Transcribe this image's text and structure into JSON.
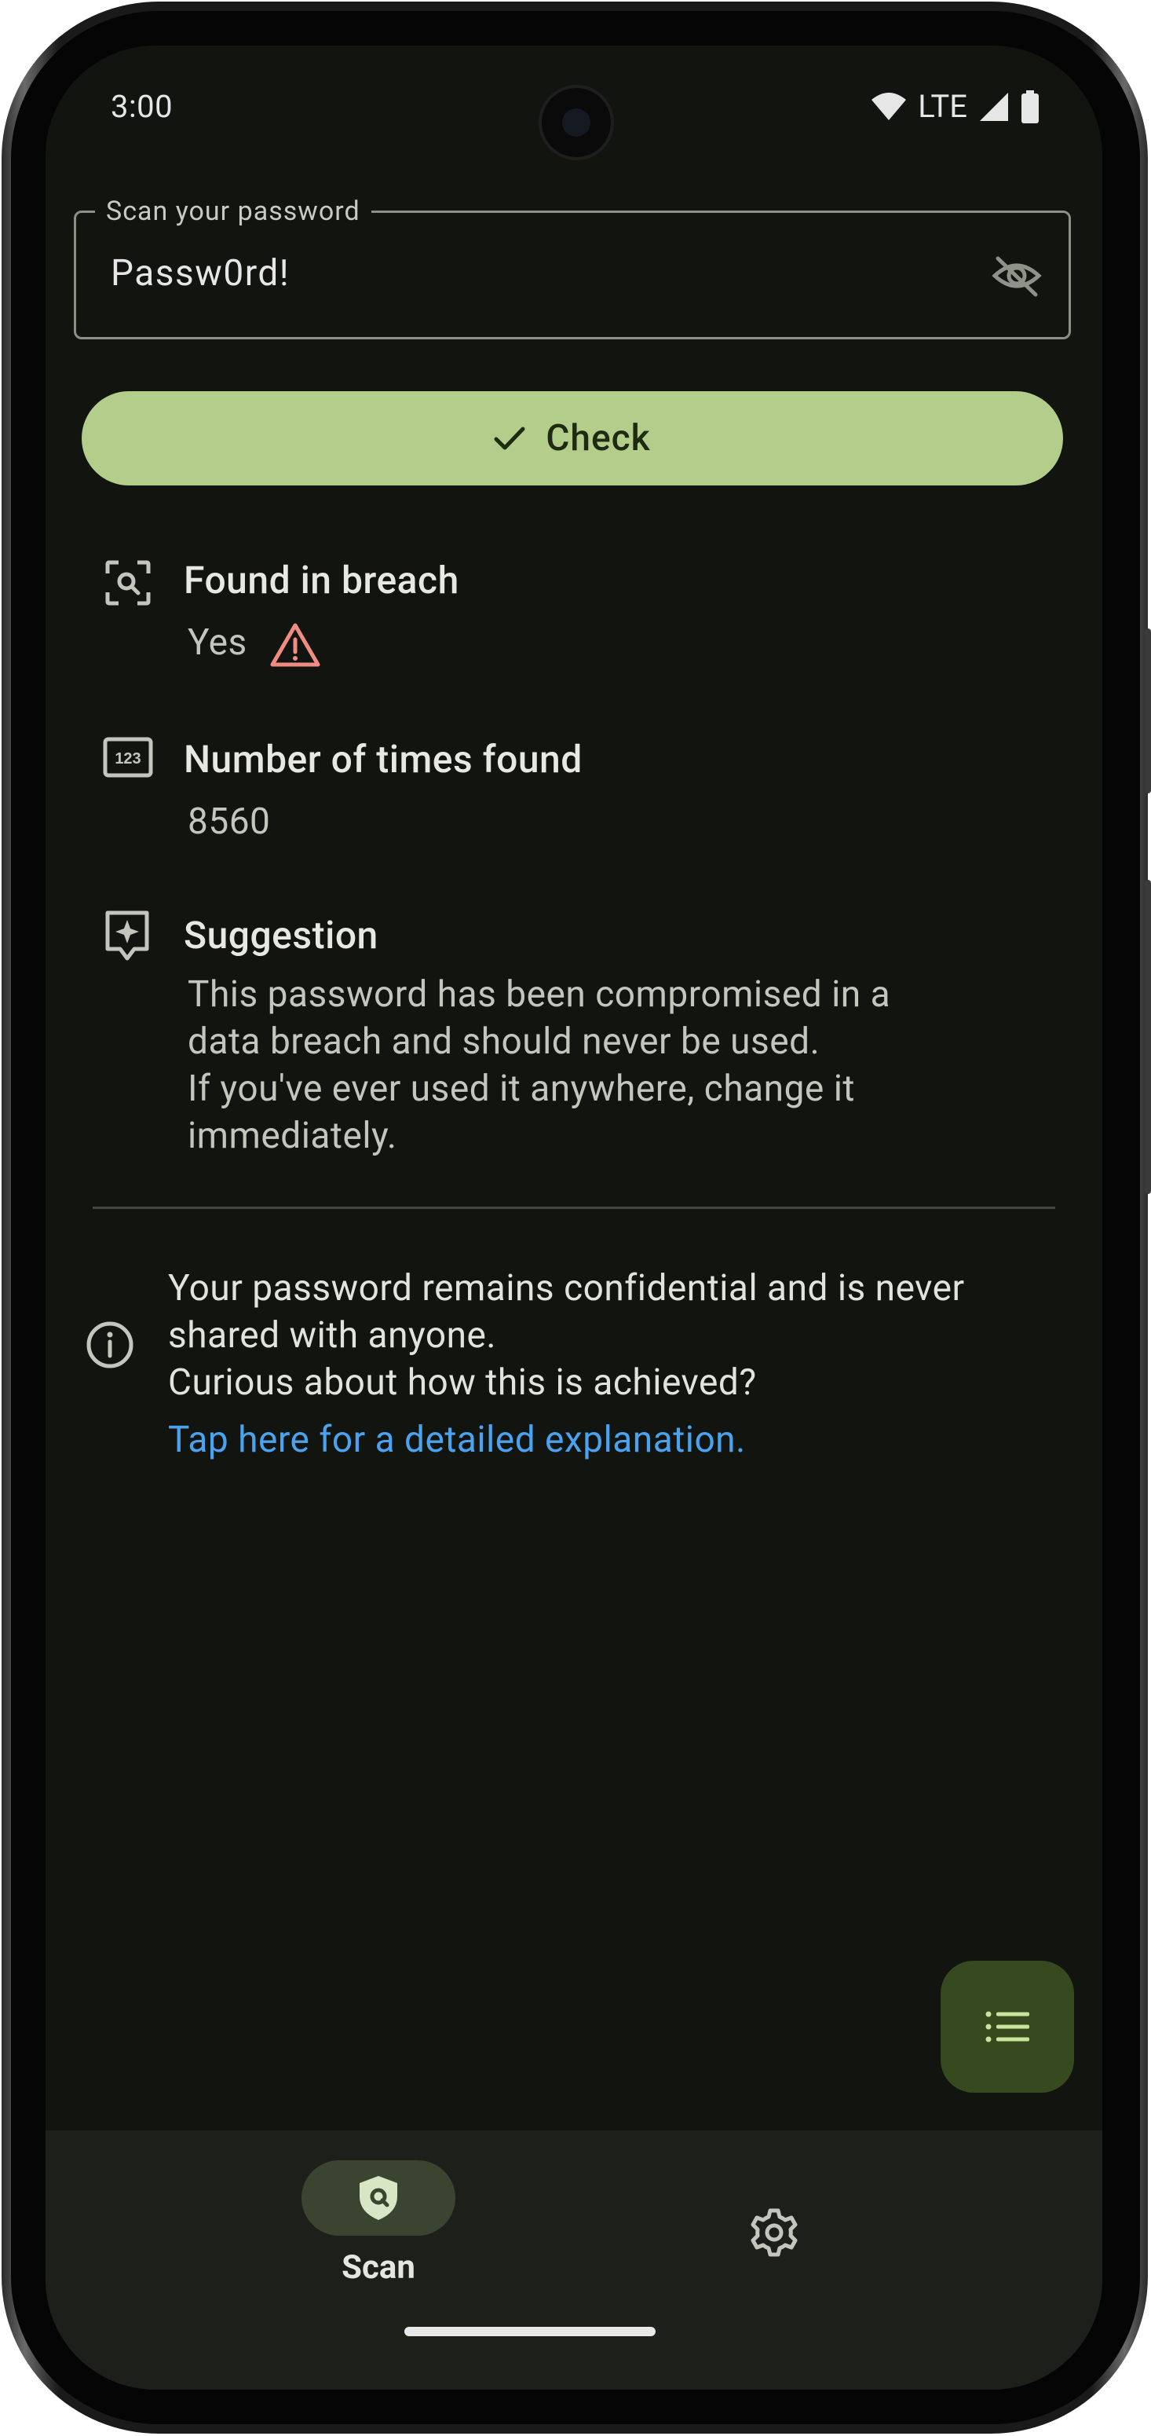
{
  "status_bar": {
    "time": "3:00",
    "network": "LTE",
    "icons": [
      "wifi-icon",
      "signal-icon",
      "battery-icon"
    ]
  },
  "password_field": {
    "label": "Scan your password",
    "value": "Passw0rd!",
    "toggle_icon": "visibility-off-icon"
  },
  "check_button": {
    "label": "Check",
    "icon": "check-icon"
  },
  "results": {
    "breach": {
      "title": "Found in breach",
      "value": "Yes",
      "icon": "search-scan-icon",
      "warning_icon": "warning-icon"
    },
    "count": {
      "title": "Number of times found",
      "value": "8560",
      "icon": "numbers-123-icon"
    },
    "suggestion": {
      "title": "Suggestion",
      "lines": [
        "This password has been compromised in a",
        "data breach and should never be used.",
        "If you've ever used it anywhere, change it",
        "immediately."
      ],
      "icon": "sparkle-icon"
    }
  },
  "info": {
    "lines": [
      "Your password remains confidential and is never",
      "shared with anyone.",
      "Curious about how this is achieved?"
    ],
    "link": "Tap here for a detailed explanation.",
    "icon": "info-icon"
  },
  "fab": {
    "icon": "list-icon"
  },
  "bottom_nav": {
    "items": [
      {
        "label": "Scan",
        "icon": "shield-search-icon",
        "selected": true
      },
      {
        "label": "",
        "icon": "gear-icon",
        "selected": false
      }
    ]
  },
  "colors": {
    "background": "#121410",
    "accent": "#b2ce8a",
    "fab": "#37491f",
    "link": "#4aa3f0",
    "warning": "#f08c84"
  }
}
